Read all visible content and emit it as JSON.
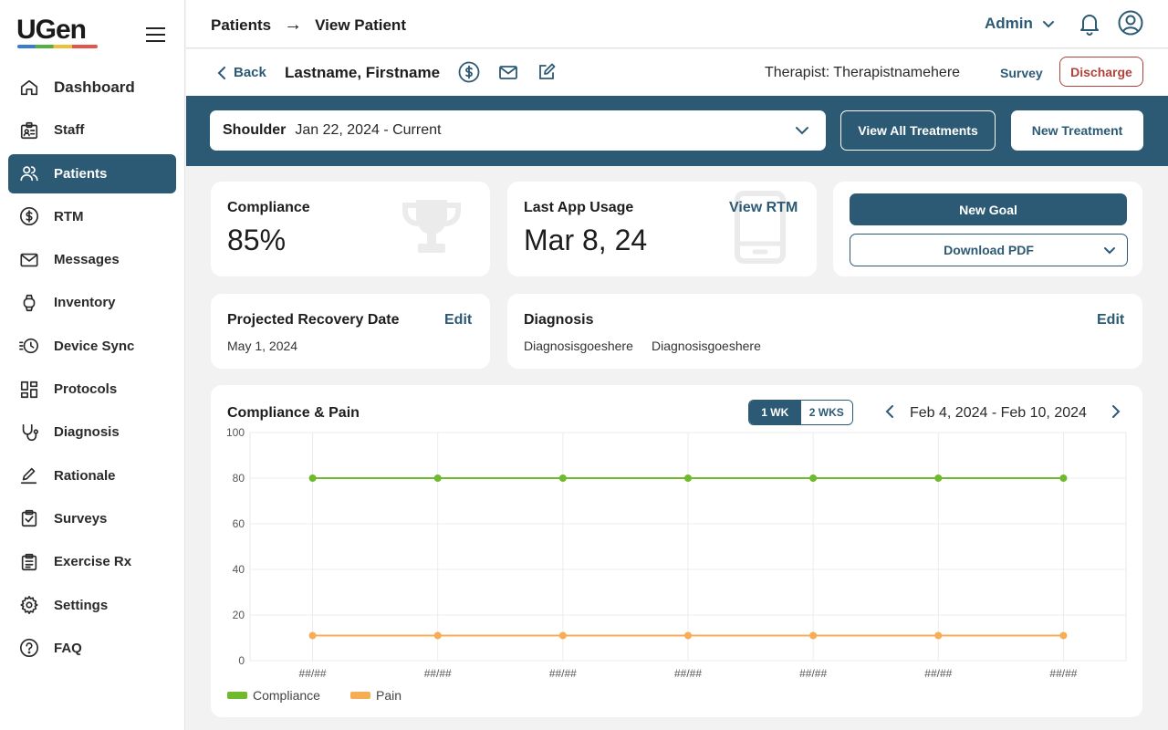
{
  "app": {
    "logo": "UGen"
  },
  "colors": {
    "primary": "#2c5a74",
    "compliance": "#6fba2c",
    "pain": "#f6ad55",
    "danger": "#b0423c"
  },
  "sidebar": {
    "items": [
      {
        "label": "Dashboard",
        "icon": "home-icon",
        "active": false
      },
      {
        "label": "Staff",
        "icon": "id-badge-icon",
        "active": false
      },
      {
        "label": "Patients",
        "icon": "people-icon",
        "active": true
      },
      {
        "label": "RTM",
        "icon": "dollar-icon",
        "active": false
      },
      {
        "label": "Messages",
        "icon": "mail-icon",
        "active": false
      },
      {
        "label": "Inventory",
        "icon": "watch-icon",
        "active": false
      },
      {
        "label": "Device Sync",
        "icon": "clock-sync-icon",
        "active": false
      },
      {
        "label": "Protocols",
        "icon": "grid-icon",
        "active": false
      },
      {
        "label": "Diagnosis",
        "icon": "stethoscope-icon",
        "active": false
      },
      {
        "label": "Rationale",
        "icon": "pen-icon",
        "active": false
      },
      {
        "label": "Surveys",
        "icon": "clipboard-check-icon",
        "active": false
      },
      {
        "label": "Exercise Rx",
        "icon": "clipboard-list-icon",
        "active": false
      },
      {
        "label": "Settings",
        "icon": "gear-icon",
        "active": false
      },
      {
        "label": "FAQ",
        "icon": "question-icon",
        "active": false
      }
    ]
  },
  "topbar": {
    "crumb_parent": "Patients",
    "crumb_arrow": "→",
    "crumb_current": "View Patient",
    "user_label": "Admin"
  },
  "patient": {
    "back_label": "Back",
    "name": "Lastname, Firstname",
    "therapist": "Therapist: Therapistnamehere",
    "survey_label": "Survey",
    "discharge_label": "Discharge"
  },
  "treatment": {
    "body_part": "Shoulder",
    "date_range": "Jan 22, 2024 - Current",
    "view_all_label": "View All Treatments",
    "new_label": "New Treatment"
  },
  "compliance": {
    "title": "Compliance",
    "value": "85%"
  },
  "usage": {
    "title": "Last App Usage",
    "value": "Mar 8, 24",
    "link": "View RTM"
  },
  "actions": {
    "goal_label": "New Goal",
    "pdf_label": "Download PDF"
  },
  "recovery": {
    "title": "Projected Recovery Date",
    "date": "May 1, 2024",
    "edit_label": "Edit"
  },
  "diagnosis": {
    "title": "Diagnosis",
    "items": [
      "Diagnosisgoeshere",
      "Diagnosisgoeshere"
    ],
    "edit_label": "Edit"
  },
  "chart_card": {
    "title": "Compliance & Pain",
    "toggle": [
      "1 WK",
      "2 WKS"
    ],
    "active_toggle": "1 WK",
    "range": "Feb 4, 2024 - Feb 10, 2024"
  },
  "chart_data": {
    "type": "line",
    "title": "Compliance & Pain",
    "x": [
      "##/##",
      "##/##",
      "##/##",
      "##/##",
      "##/##",
      "##/##",
      "##/##"
    ],
    "ylim": [
      0,
      100
    ],
    "yticks": [
      0,
      20,
      40,
      60,
      80,
      100
    ],
    "grid": true,
    "legend": "bottom-left",
    "series": [
      {
        "name": "Compliance",
        "color": "#6fba2c",
        "values": [
          80,
          80,
          80,
          80,
          80,
          80,
          80
        ]
      },
      {
        "name": "Pain",
        "color": "#f6ad55",
        "values": [
          11,
          11,
          11,
          11,
          11,
          11,
          11
        ]
      }
    ]
  }
}
